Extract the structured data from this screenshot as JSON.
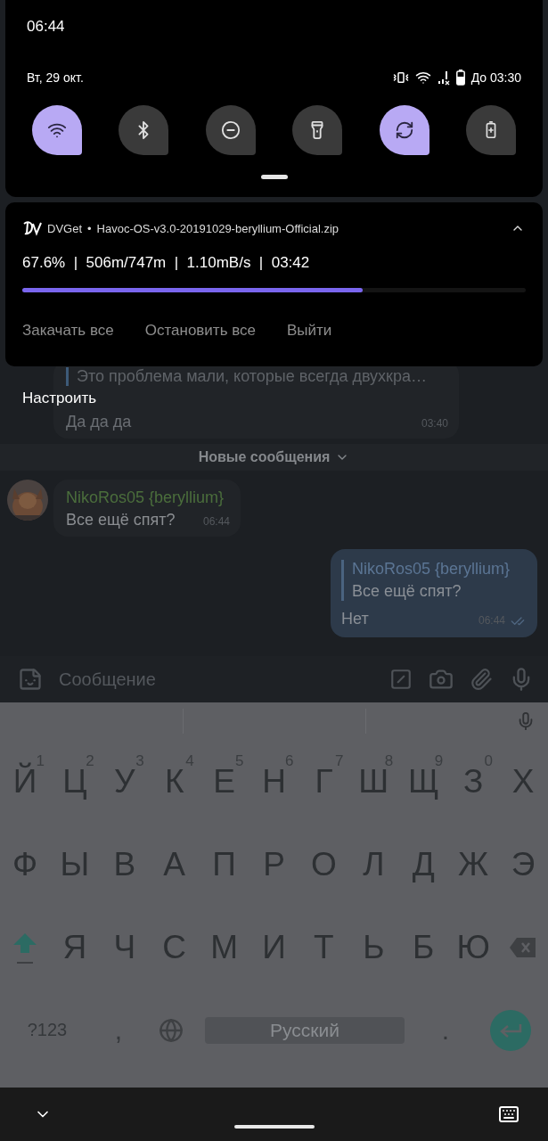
{
  "status_bar": {
    "time": "06:44"
  },
  "quick_settings": {
    "date": "Вт, 29 окт.",
    "battery_text": "До 03:30",
    "tiles": [
      {
        "kind": "wifi",
        "on": true
      },
      {
        "kind": "bluetooth",
        "on": false
      },
      {
        "kind": "dnd",
        "on": false
      },
      {
        "kind": "flashlight",
        "on": false
      },
      {
        "kind": "rotate",
        "on": true
      },
      {
        "kind": "battery_saver",
        "on": false
      }
    ]
  },
  "notification": {
    "app": "DVGet",
    "separator": "•",
    "title": "Havoc-OS-v3.0-20191029-beryllium-Official.zip",
    "progress_text": "67.6%  |  506m/747m  |  1.10mB/s  |  03:42",
    "level": 0.676,
    "actions": [
      "Закачать все",
      "Остановить все",
      "Выйти"
    ]
  },
  "shade_footer": "Настроить",
  "chat": {
    "first_bubble": {
      "quote": "Это проблема мали, которые всегда двухкра…",
      "text": "Да да да",
      "time": "03:40"
    },
    "new_messages_divider": "Новые сообщения",
    "incoming": {
      "sender": "NikoRos05 {beryllium}",
      "text": "Все ещё спят?",
      "time": "06:44"
    },
    "outgoing": {
      "reply_sender": "NikoRos05 {beryllium}",
      "reply_text": "Все ещё спят?",
      "text": "Нет",
      "time": "06:44",
      "read": true
    },
    "composer": {
      "placeholder": "Сообщение"
    }
  },
  "keyboard": {
    "rows": [
      [
        {
          "label": "Й",
          "hint": "1"
        },
        {
          "label": "Ц",
          "hint": "2"
        },
        {
          "label": "У",
          "hint": "3"
        },
        {
          "label": "К",
          "hint": "4"
        },
        {
          "label": "Е",
          "hint": "5"
        },
        {
          "label": "Н",
          "hint": "6"
        },
        {
          "label": "Г",
          "hint": "7"
        },
        {
          "label": "Ш",
          "hint": "8"
        },
        {
          "label": "Щ",
          "hint": "9"
        },
        {
          "label": "З",
          "hint": "0"
        },
        {
          "label": "Х"
        }
      ],
      [
        {
          "label": "Ф"
        },
        {
          "label": "Ы"
        },
        {
          "label": "В"
        },
        {
          "label": "А"
        },
        {
          "label": "П"
        },
        {
          "label": "Р"
        },
        {
          "label": "О"
        },
        {
          "label": "Л"
        },
        {
          "label": "Д"
        },
        {
          "label": "Ж"
        },
        {
          "label": "Э"
        }
      ],
      [
        {
          "kind": "shift"
        },
        {
          "label": "Я"
        },
        {
          "label": "Ч"
        },
        {
          "label": "С"
        },
        {
          "label": "М"
        },
        {
          "label": "И"
        },
        {
          "label": "Т"
        },
        {
          "label": "Ь"
        },
        {
          "label": "Б"
        },
        {
          "label": "Ю"
        },
        {
          "kind": "backspace"
        }
      ]
    ],
    "symbols": "?123",
    "comma": ",",
    "space": "Русский",
    "period": "."
  }
}
